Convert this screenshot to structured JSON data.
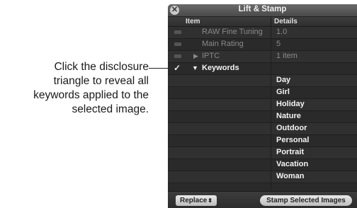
{
  "callout": {
    "text_lines": [
      "Click the disclosure",
      "triangle to reveal all",
      "keywords applied to the",
      "selected image."
    ]
  },
  "window": {
    "title": "Lift & Stamp",
    "close_icon": "close-icon"
  },
  "columns": {
    "item": "Item",
    "details": "Details"
  },
  "rows": [
    {
      "item": "RAW Fine Tuning",
      "details": "1.0",
      "checked": false
    },
    {
      "item": "Main Rating",
      "details": "5",
      "checked": false
    },
    {
      "item": "IPTC",
      "details": "1 item",
      "checked": false,
      "disclosure": "collapsed"
    },
    {
      "item": "Keywords",
      "details": "",
      "checked": true,
      "disclosure": "expanded"
    },
    {
      "item": "",
      "details": "Day"
    },
    {
      "item": "",
      "details": "Girl"
    },
    {
      "item": "",
      "details": "Holiday"
    },
    {
      "item": "",
      "details": "Nature"
    },
    {
      "item": "",
      "details": "Outdoor"
    },
    {
      "item": "",
      "details": "Personal"
    },
    {
      "item": "",
      "details": "Portrait"
    },
    {
      "item": "",
      "details": "Vacation"
    },
    {
      "item": "",
      "details": "Woman"
    }
  ],
  "footer": {
    "replace_label": "Replace",
    "stamp_label": "Stamp Selected Images"
  }
}
